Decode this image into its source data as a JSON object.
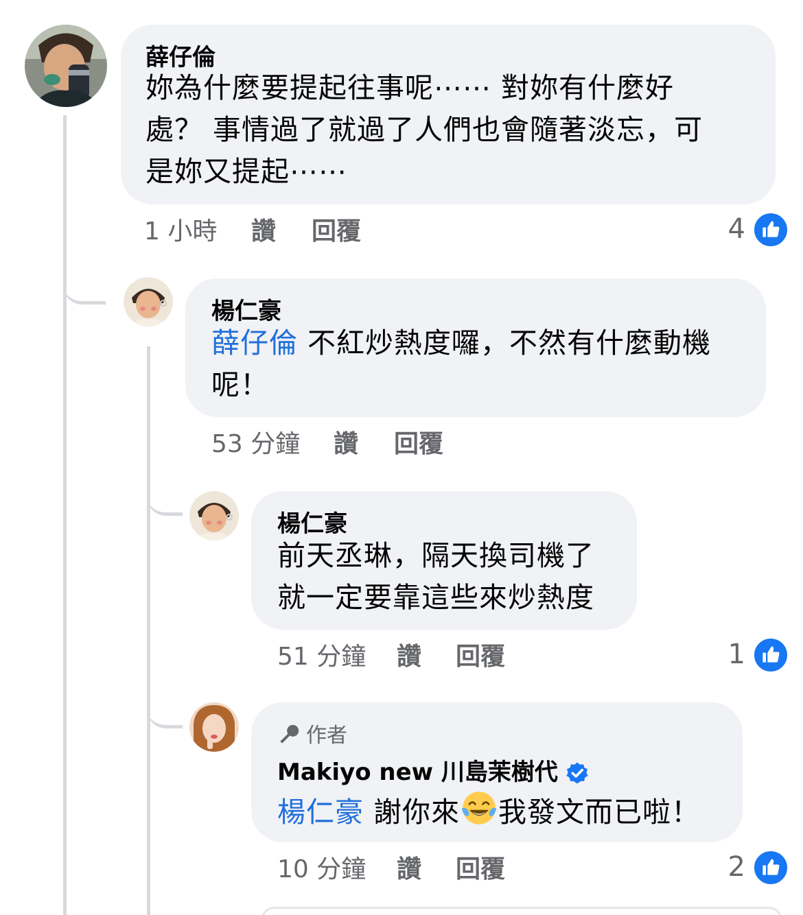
{
  "comments": [
    {
      "author": "薛仔倫",
      "text_lines": [
        "妳為什麼要提起往事呢⋯⋯ 對妳有什麼好",
        "處？ 事情過了就過了人們也會隨著淡忘，可",
        "是妳又提起⋯⋯"
      ],
      "time": "1 小時",
      "like_label": "讚",
      "reply_label": "回覆",
      "reactions": "4"
    },
    {
      "author": "楊仁豪",
      "mention": "薛仔倫",
      "text_first": " 不紅炒熱度囉，不然有什麼動機",
      "text_lines": [
        "呢！"
      ],
      "time": "53 分鐘",
      "like_label": "讚",
      "reply_label": "回覆"
    },
    {
      "author": "楊仁豪",
      "text_lines": [
        "前天丞琳，隔天換司機了",
        "就一定要靠這些來炒熱度"
      ],
      "time": "51 分鐘",
      "like_label": "讚",
      "reply_label": "回覆",
      "reactions": "1"
    },
    {
      "badge": "作者",
      "author": "Makiyo new 川島茉樹代",
      "mention": "楊仁豪",
      "text_a": " 謝你來",
      "emoji": "tears-of-joy",
      "text_b": "我發文而已啦！",
      "time": "10 分鐘",
      "like_label": "讚",
      "reply_label": "回覆",
      "reactions": "2"
    }
  ],
  "colors": {
    "bubble": "#f0f2f5",
    "mention": "#216fdb",
    "meta": "#65676b",
    "like_badge": "#1877f2",
    "thread_line": "#d7d9dd"
  }
}
